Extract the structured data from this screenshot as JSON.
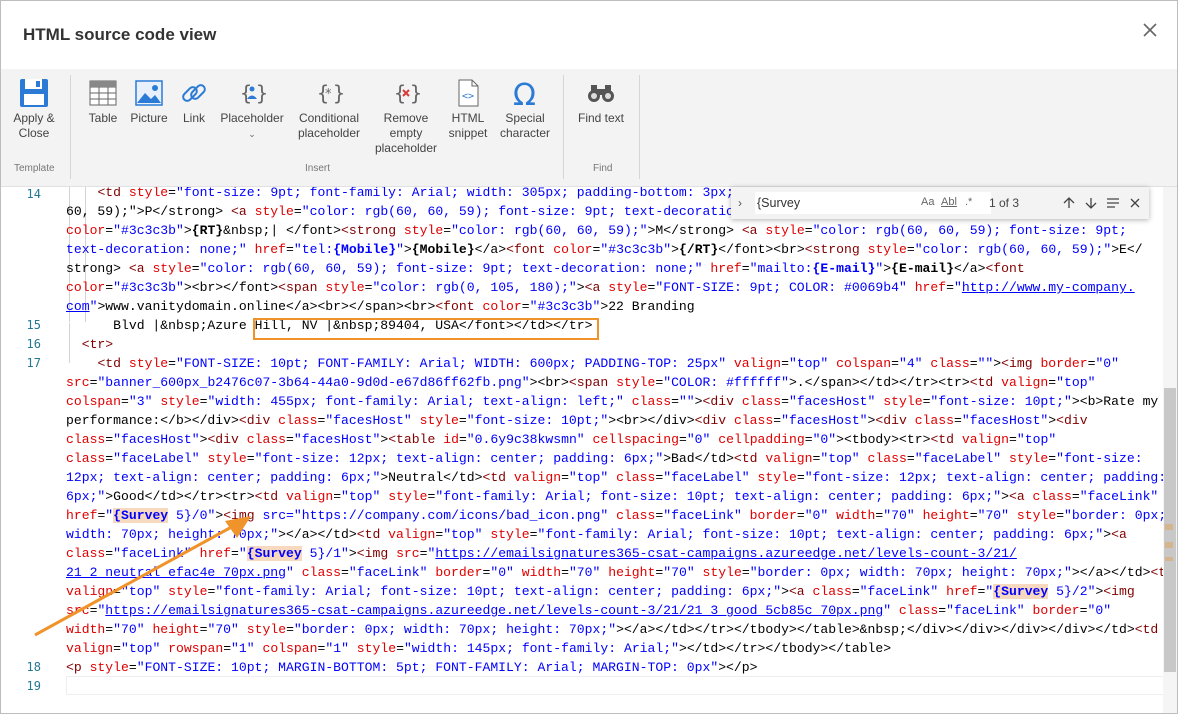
{
  "dialog": {
    "title": "HTML source code view"
  },
  "ribbon": {
    "apply_close": "Apply &\nClose",
    "template_group": "Template",
    "table": "Table",
    "picture": "Picture",
    "link": "Link",
    "placeholder": "Placeholder",
    "conditional_placeholder": "Conditional\nplaceholder",
    "remove_empty_placeholder": "Remove\nempty\nplaceholder",
    "html_snippet": "HTML\nsnippet",
    "special_character": "Special\ncharacter",
    "insert_group": "Insert",
    "find_text": "Find text",
    "find_group": "Find"
  },
  "find_widget": {
    "query": "{Survey",
    "count": "1 of 3",
    "match_case": "Aa",
    "whole_word": "Abl",
    "regex": ".*"
  },
  "editor": {
    "line_numbers": [
      "14",
      "15",
      "16",
      "17",
      "18",
      "19"
    ],
    "highlighted_url": "src=\"https://company.com/icons/bad_icon.png\""
  }
}
